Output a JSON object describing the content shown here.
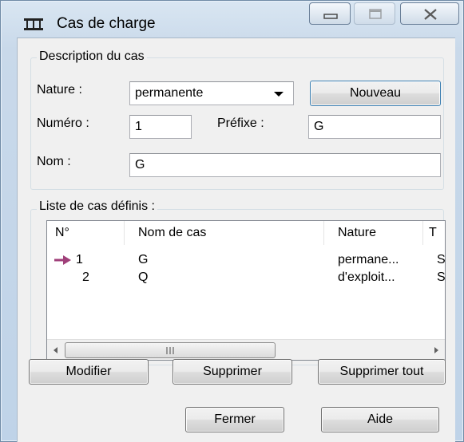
{
  "window": {
    "title": "Cas de charge",
    "icon": "beam-icon"
  },
  "description_group": {
    "label": "Description du cas",
    "nature_label": "Nature :",
    "nature_value": "permanente",
    "new_button": "Nouveau",
    "numero_label": "Numéro :",
    "numero_value": "1",
    "prefixe_label": "Préfixe :",
    "prefixe_value": "G",
    "nom_label": "Nom :",
    "nom_value": "G"
  },
  "list_group": {
    "label": "Liste de cas définis :",
    "columns": [
      "N°",
      "Nom de cas",
      "Nature",
      "T"
    ],
    "rows": [
      {
        "num": "1",
        "name": "G",
        "nature": "permane...",
        "t": "S",
        "current": true
      },
      {
        "num": "2",
        "name": "Q",
        "nature": "d'exploit...",
        "t": "S",
        "current": false
      }
    ],
    "scroll_grip": "III"
  },
  "buttons": {
    "modify": "Modifier",
    "delete": "Supprimer",
    "delete_all": "Supprimer tout",
    "close": "Fermer",
    "help": "Aide"
  },
  "colors": {
    "current_arrow": "#a0407a"
  }
}
